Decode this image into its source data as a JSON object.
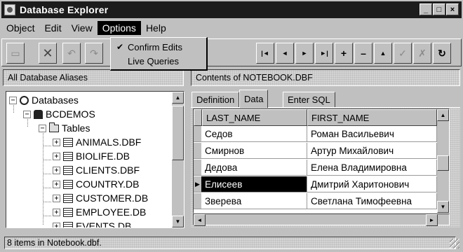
{
  "window": {
    "title": "Database Explorer",
    "buttons": [
      "_",
      "□",
      "×"
    ]
  },
  "menubar": [
    {
      "label": "Object",
      "active": false
    },
    {
      "label": "Edit",
      "active": false
    },
    {
      "label": "View",
      "active": false
    },
    {
      "label": "Options",
      "active": true
    },
    {
      "label": "Help",
      "active": false
    }
  ],
  "options_menu": {
    "items": [
      {
        "label": "Confirm Edits",
        "checked": true
      },
      {
        "label": "Live Queries",
        "checked": false
      }
    ]
  },
  "toolbar": {
    "left_icons": [
      "open-icon",
      "delete-icon",
      "undo-icon",
      "redo-icon"
    ],
    "nav_buttons": [
      {
        "name": "first-record-icon",
        "glyph": "|◄"
      },
      {
        "name": "prior-record-icon",
        "glyph": "◄"
      },
      {
        "name": "next-record-icon",
        "glyph": "►"
      },
      {
        "name": "last-record-icon",
        "glyph": "►|"
      },
      {
        "name": "insert-record-icon",
        "glyph": "+"
      },
      {
        "name": "delete-record-icon",
        "glyph": "–"
      },
      {
        "name": "edit-record-icon",
        "glyph": "▲"
      },
      {
        "name": "post-edit-icon",
        "glyph": "✓"
      },
      {
        "name": "cancel-edit-icon",
        "glyph": "✗"
      },
      {
        "name": "refresh-icon",
        "glyph": "↻"
      }
    ]
  },
  "left_panel": {
    "header": "All Database Aliases",
    "tree": {
      "root": "Databases",
      "alias": "BCDEMOS",
      "folder": "Tables",
      "tables": [
        "ANIMALS.DBF",
        "BIOLIFE.DB",
        "CLIENTS.DBF",
        "COUNTRY.DB",
        "CUSTOMER.DB",
        "EMPLOYEE.DB",
        "EVENTS.DB"
      ]
    }
  },
  "right_panel": {
    "header": "Contents of NOTEBOOK.DBF",
    "tabs": [
      {
        "label": "Definition",
        "active": false
      },
      {
        "label": "Data",
        "active": true
      },
      {
        "label": "Enter SQL",
        "active": false
      }
    ],
    "grid": {
      "columns": [
        "LAST_NAME",
        "FIRST_NAME"
      ],
      "rows": [
        [
          "Седов",
          "Роман Васильевич"
        ],
        [
          "Смирнов",
          "Артур Михайлович"
        ],
        [
          "Дедова",
          "Елена Владимировна"
        ],
        [
          "Елисеев",
          "Дмитрий Харитонович"
        ],
        [
          "Зверева",
          "Светлана Тимофеевна"
        ]
      ],
      "selected_row": 3
    }
  },
  "statusbar": {
    "text": "8 items in Notebook.dbf."
  }
}
